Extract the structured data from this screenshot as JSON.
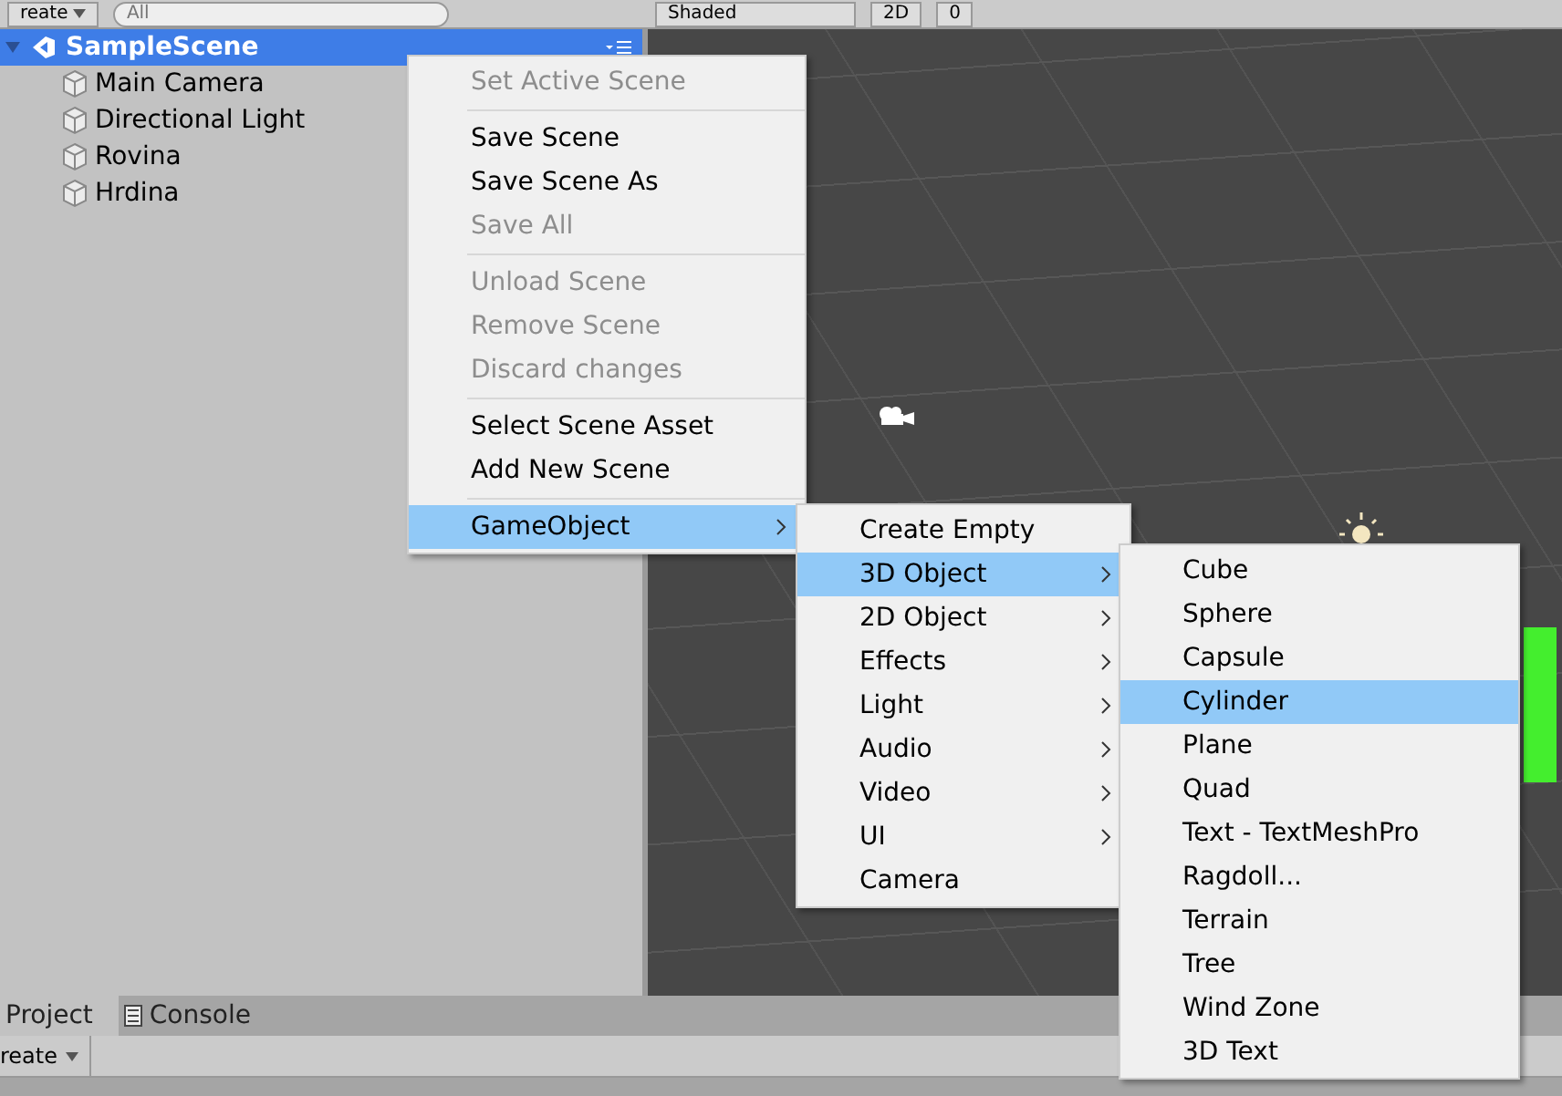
{
  "hierarchy_toolbar": {
    "create_label": "reate",
    "search": {
      "placeholder": "All"
    }
  },
  "scene_toolbar": {
    "shading": "Shaded",
    "mode_2d": "2D",
    "hidden_count": "0"
  },
  "hierarchy": {
    "scene": {
      "name": "SampleScene",
      "selected": true
    },
    "items": [
      {
        "label": "Main Camera",
        "selected": false
      },
      {
        "label": "Directional Light",
        "selected": false
      },
      {
        "label": "Rovina",
        "selected": false
      },
      {
        "label": "Hrdina",
        "selected": false
      }
    ]
  },
  "menus": [
    {
      "items": [
        {
          "kind": "item",
          "label": "Set Active Scene",
          "disabled": true,
          "selected": false
        },
        {
          "kind": "separator"
        },
        {
          "kind": "item",
          "label": "Save Scene",
          "disabled": false,
          "selected": false
        },
        {
          "kind": "item",
          "label": "Save Scene As",
          "disabled": false,
          "selected": false
        },
        {
          "kind": "item",
          "label": "Save All",
          "disabled": true,
          "selected": false
        },
        {
          "kind": "separator"
        },
        {
          "kind": "item",
          "label": "Unload Scene",
          "disabled": true,
          "selected": false
        },
        {
          "kind": "item",
          "label": "Remove Scene",
          "disabled": true,
          "selected": false
        },
        {
          "kind": "item",
          "label": "Discard changes",
          "disabled": true,
          "selected": false
        },
        {
          "kind": "separator"
        },
        {
          "kind": "item",
          "label": "Select Scene Asset",
          "disabled": false,
          "selected": false
        },
        {
          "kind": "item",
          "label": "Add New Scene",
          "disabled": false,
          "selected": false
        },
        {
          "kind": "separator"
        },
        {
          "kind": "submenu",
          "label": "GameObject",
          "disabled": false,
          "selected": true
        }
      ]
    },
    {
      "items": [
        {
          "kind": "item",
          "label": "Create Empty",
          "disabled": false,
          "selected": false
        },
        {
          "kind": "submenu",
          "label": "3D Object",
          "disabled": false,
          "selected": true
        },
        {
          "kind": "submenu",
          "label": "2D Object",
          "disabled": false,
          "selected": false
        },
        {
          "kind": "submenu",
          "label": "Effects",
          "disabled": false,
          "selected": false
        },
        {
          "kind": "submenu",
          "label": "Light",
          "disabled": false,
          "selected": false
        },
        {
          "kind": "submenu",
          "label": "Audio",
          "disabled": false,
          "selected": false
        },
        {
          "kind": "submenu",
          "label": "Video",
          "disabled": false,
          "selected": false
        },
        {
          "kind": "submenu",
          "label": "UI",
          "disabled": false,
          "selected": false
        },
        {
          "kind": "item",
          "label": "Camera",
          "disabled": false,
          "selected": false
        }
      ]
    },
    {
      "items": [
        {
          "kind": "item",
          "label": "Cube",
          "disabled": false,
          "selected": false
        },
        {
          "kind": "item",
          "label": "Sphere",
          "disabled": false,
          "selected": false
        },
        {
          "kind": "item",
          "label": "Capsule",
          "disabled": false,
          "selected": false
        },
        {
          "kind": "item",
          "label": "Cylinder",
          "disabled": false,
          "selected": true
        },
        {
          "kind": "item",
          "label": "Plane",
          "disabled": false,
          "selected": false
        },
        {
          "kind": "item",
          "label": "Quad",
          "disabled": false,
          "selected": false
        },
        {
          "kind": "item",
          "label": "Text - TextMeshPro",
          "disabled": false,
          "selected": false
        },
        {
          "kind": "item",
          "label": "Ragdoll...",
          "disabled": false,
          "selected": false
        },
        {
          "kind": "item",
          "label": "Terrain",
          "disabled": false,
          "selected": false
        },
        {
          "kind": "item",
          "label": "Tree",
          "disabled": false,
          "selected": false
        },
        {
          "kind": "item",
          "label": "Wind Zone",
          "disabled": false,
          "selected": false
        },
        {
          "kind": "item",
          "label": "3D Text",
          "disabled": false,
          "selected": false
        }
      ]
    }
  ],
  "bottom_tabs": [
    {
      "label": "Project",
      "selected": true
    },
    {
      "label": "Console",
      "selected": false
    }
  ],
  "project_toolbar": {
    "create_label": "reate"
  }
}
